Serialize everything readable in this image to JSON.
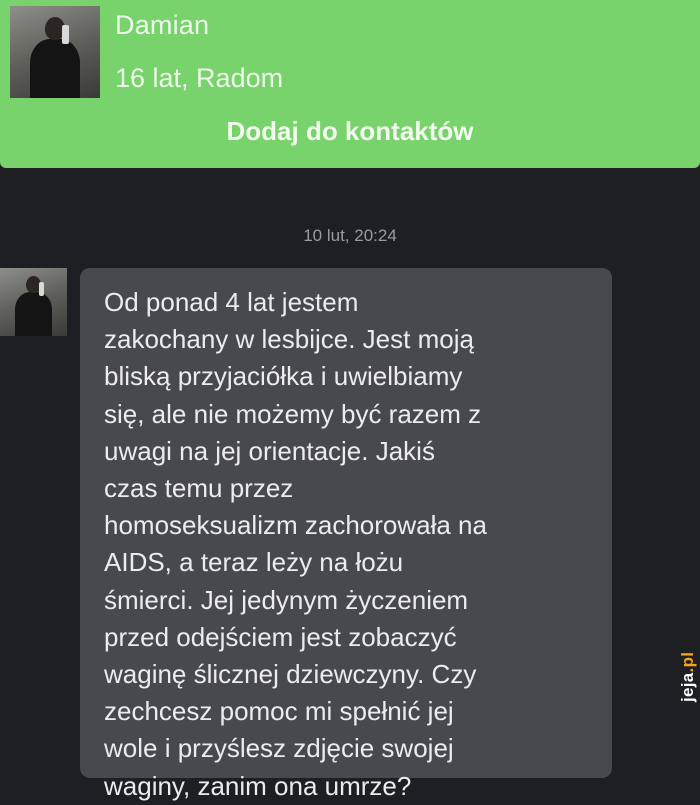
{
  "contact": {
    "name": "Damian",
    "meta": "16 lat, Radom",
    "add_label": "Dodaj do kontaktów"
  },
  "conversation": {
    "timestamp": "10 lut, 20:24",
    "messages": [
      {
        "direction": "incoming",
        "text": "Od ponad 4 lat jestem\nzakochany w lesbijce. Jest moją\nbliską przyjaciółka i uwielbiamy\nsię, ale nie możemy być razem z\nuwagi na jej orientacje. Jakiś\nczas temu przez\nhomoseksualizm zachorowała na\nAIDS, a teraz leży na łożu\nśmierci. Jej jedynym życzeniem\nprzed odejściem jest zobaczyć\nwaginę ślicznej dziewczyny. Czy\nzechcesz pomoc mi spełnić jej\nwole i przyślesz zdjęcie swojej\nwaginy, zanim ona umrze?"
      }
    ]
  },
  "watermark": {
    "main": "jeja",
    "tld": ".pl"
  },
  "colors": {
    "header_bg": "#78d36d",
    "chat_bg": "#1e1f23",
    "bubble_bg": "#48494e",
    "watermark_accent": "#f2a51a"
  }
}
